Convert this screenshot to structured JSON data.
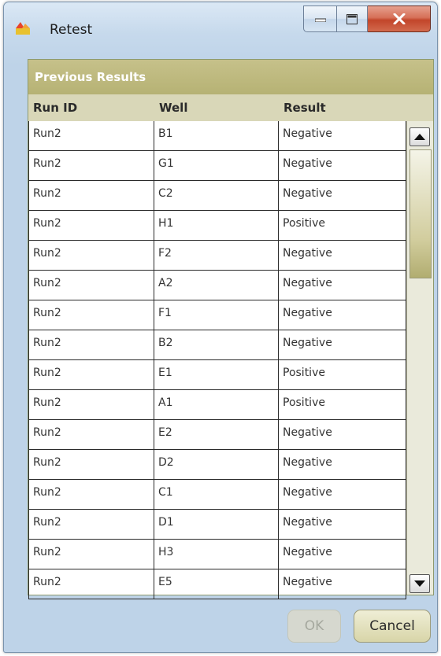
{
  "window": {
    "title": "Retest",
    "controls": {
      "minimize": "minimize",
      "maximize": "maximize",
      "close": "close"
    }
  },
  "panel": {
    "header": "Previous Results",
    "columns": [
      "Run ID",
      "Well",
      "Result"
    ],
    "rows": [
      [
        "Run2",
        "B1",
        "Negative"
      ],
      [
        "Run2",
        "G1",
        "Negative"
      ],
      [
        "Run2",
        "C2",
        "Negative"
      ],
      [
        "Run2",
        "H1",
        "Positive"
      ],
      [
        "Run2",
        "F2",
        "Negative"
      ],
      [
        "Run2",
        "A2",
        "Negative"
      ],
      [
        "Run2",
        "F1",
        "Negative"
      ],
      [
        "Run2",
        "B2",
        "Negative"
      ],
      [
        "Run2",
        "E1",
        "Positive"
      ],
      [
        "Run2",
        "A1",
        "Positive"
      ],
      [
        "Run2",
        "E2",
        "Negative"
      ],
      [
        "Run2",
        "D2",
        "Negative"
      ],
      [
        "Run2",
        "C1",
        "Negative"
      ],
      [
        "Run2",
        "D1",
        "Negative"
      ],
      [
        "Run2",
        "H3",
        "Negative"
      ],
      [
        "Run2",
        "E5",
        "Negative"
      ]
    ]
  },
  "buttons": {
    "ok": "OK",
    "cancel": "Cancel"
  },
  "icons": {
    "app": "app-icon",
    "minimize": "minimize-icon",
    "maximize": "maximize-icon",
    "close": "close-icon",
    "scroll_up": "scroll-up-arrow-icon",
    "scroll_down": "scroll-down-arrow-icon"
  },
  "colors": {
    "header_bg": "#b6b274",
    "column_header_bg": "#d9d7b8",
    "window_bg": "#bed3e8",
    "close_button": "#c2452a"
  }
}
